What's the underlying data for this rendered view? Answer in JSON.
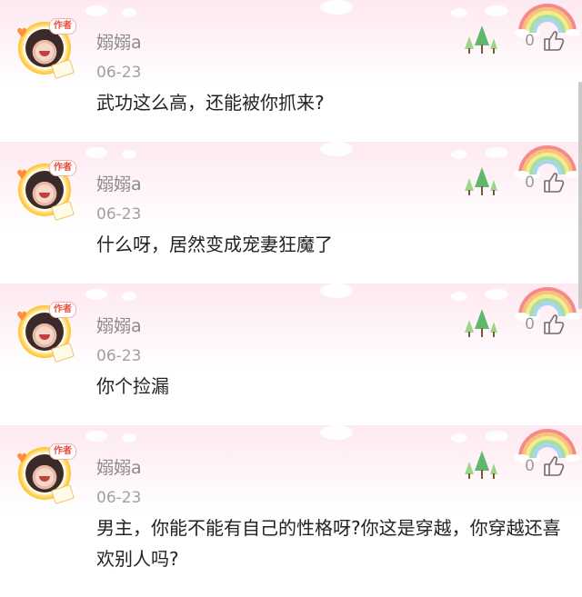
{
  "comments": [
    {
      "username": "嫋嫋a",
      "badge": "作者",
      "date": "06-23",
      "text": "武功这么高，还能被你抓来?",
      "likes": "0"
    },
    {
      "username": "嫋嫋a",
      "badge": "作者",
      "date": "06-23",
      "text": "什么呀，居然变成宠妻狂魔了",
      "likes": "0"
    },
    {
      "username": "嫋嫋a",
      "badge": "作者",
      "date": "06-23",
      "text": "你个捡漏",
      "likes": "0"
    },
    {
      "username": "嫋嫋a",
      "badge": "作者",
      "date": "06-23",
      "text": "男主，你能不能有自己的性格呀?你这是穿越，你穿越还喜欢别人吗?",
      "likes": "0"
    }
  ],
  "colors": {
    "accent_pink": "#fde9f1",
    "username_gray": "#8a8a8a",
    "text_dark": "#222222"
  },
  "icons": {
    "like": "thumbs-up-icon",
    "rainbow": "rainbow-icon",
    "trees": "tree-icon",
    "cloud": "cloud-icon"
  }
}
